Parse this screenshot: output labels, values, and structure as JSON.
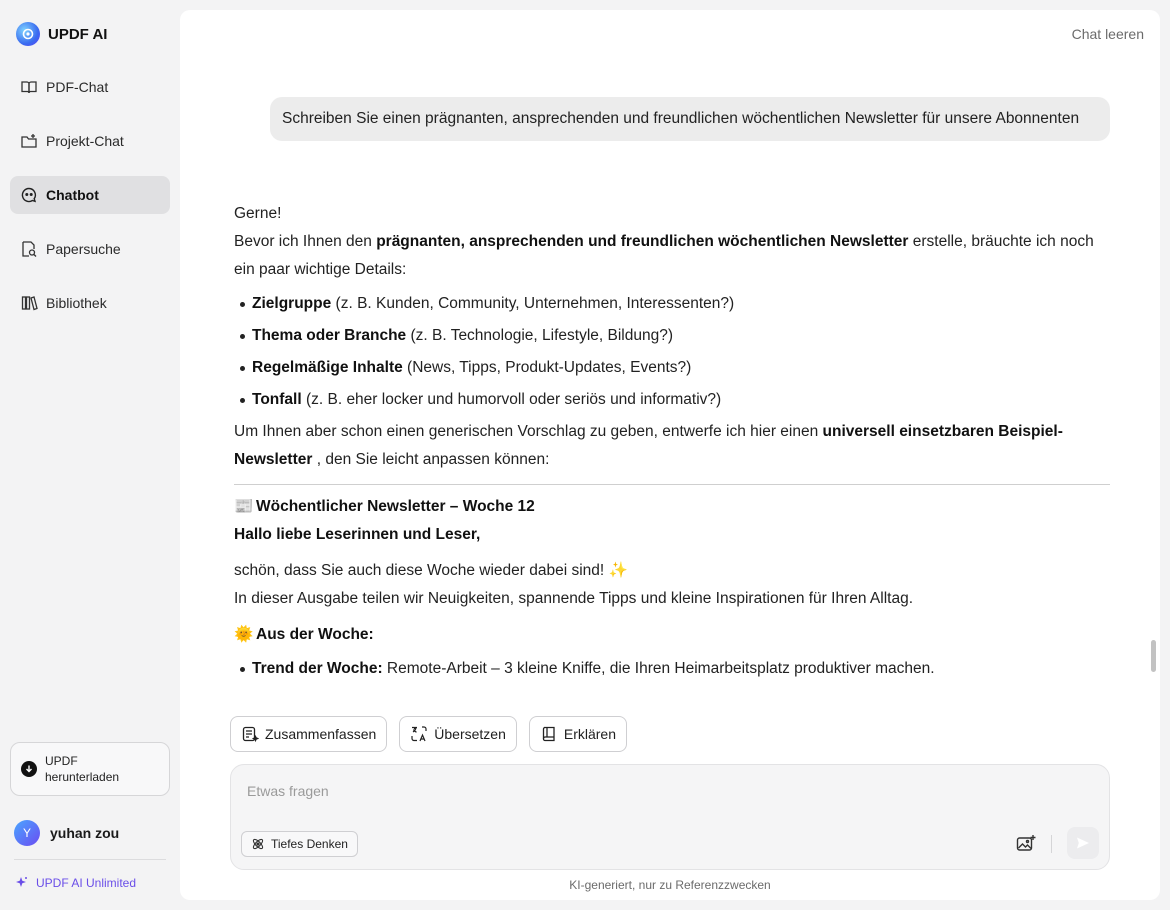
{
  "sidebar": {
    "brand": "UPDF AI",
    "items": [
      {
        "label": "PDF-Chat",
        "icon": "book-open-icon"
      },
      {
        "label": "Projekt-Chat",
        "icon": "folder-plus-icon"
      },
      {
        "label": "Chatbot",
        "icon": "chatbot-icon",
        "active": true
      },
      {
        "label": "Papersuche",
        "icon": "paper-search-icon"
      },
      {
        "label": "Bibliothek",
        "icon": "library-icon"
      }
    ],
    "download_label_line1": "UPDF",
    "download_label_line2": "herunterladen",
    "user_initial": "Y",
    "user_name": "yuhan zou",
    "unlimited_label": "UPDF AI Unlimited"
  },
  "header": {
    "clear_chat": "Chat leeren"
  },
  "conversation": {
    "user_message": "Schreiben Sie einen prägnanten, ansprechenden und freundlichen wöchentlichen Newsletter für unsere Abonnenten",
    "greeting": "Gerne!",
    "intro_pre": "Bevor ich Ihnen den ",
    "intro_bold": "prägnanten, ansprechenden und freundlichen wöchentlichen Newsletter",
    "intro_post": " erstelle, bräuchte ich noch ein paar wichtige Details:",
    "details": [
      {
        "bold": "Zielgruppe",
        "text": " (z. B. Kunden, Community, Unternehmen, Interessenten?)"
      },
      {
        "bold": "Thema oder Branche",
        "text": " (z. B. Technologie, Lifestyle, Bildung?)"
      },
      {
        "bold": "Regelmäßige Inhalte",
        "text": " (News, Tipps, Produkt-Updates, Events?)"
      },
      {
        "bold": "Tonfall",
        "text": " (z. B. eher locker und humorvoll oder seriös und informativ?)"
      }
    ],
    "proposal_pre": "Um Ihnen aber schon einen generischen Vorschlag zu geben, entwerfe ich hier einen ",
    "proposal_bold": "universell einsetzbaren Beispiel-Newsletter",
    "proposal_post": " , den Sie leicht anpassen können:",
    "nl_title_emoji": "📰",
    "nl_title": "Wöchentlicher Newsletter – Woche 12",
    "nl_greeting": "Hallo liebe Leserinnen und Leser,",
    "nl_line1": "schön, dass Sie auch diese Woche wieder dabei sind!",
    "nl_line1_emoji": "✨",
    "nl_line2": "In dieser Ausgabe teilen wir Neuigkeiten, spannende Tipps und kleine Inspirationen für Ihren Alltag.",
    "nl_section_emoji": "🌞",
    "nl_section": "Aus der Woche:",
    "nl_trend_bold": "Trend der Woche:",
    "nl_trend_text": " Remote-Arbeit – 3 kleine Kniffe, die Ihren Heimarbeitsplatz produktiver machen."
  },
  "actions": {
    "summarize": "Zusammenfassen",
    "translate": "Übersetzen",
    "explain": "Erklären"
  },
  "composer": {
    "placeholder": "Etwas fragen",
    "deep_think": "Tiefes Denken"
  },
  "footer": {
    "disclaimer": "KI-generiert, nur zu Referenzzwecken"
  },
  "colors": {
    "accent": "#6a4ee8",
    "active_bg": "#e0e0e2"
  }
}
